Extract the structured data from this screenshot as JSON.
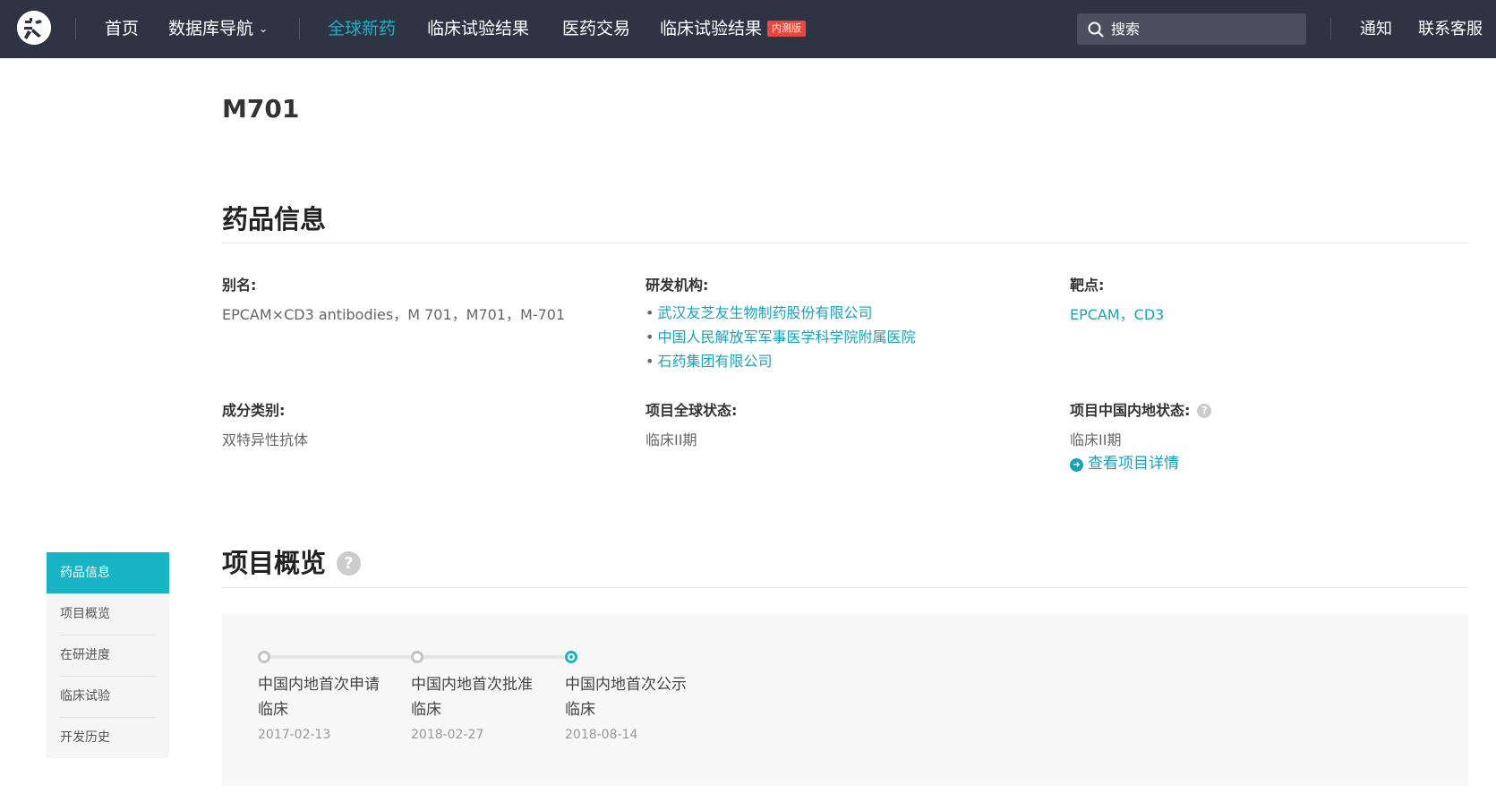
{
  "nav": {
    "items": [
      {
        "label": "首页"
      },
      {
        "label": "数据库导航",
        "caret": "⌄"
      },
      {
        "label": "全球新药",
        "active": true
      },
      {
        "label": "临床试验结果"
      },
      {
        "label": "医药交易"
      },
      {
        "label": "临床试验结果",
        "badge": "内测版"
      }
    ],
    "search_placeholder": "搜索",
    "right_items": [
      "通知",
      "联系客服"
    ],
    "accent_color": "#19b3c6",
    "badge_color": "#e8473b"
  },
  "drug": {
    "name": "M701"
  },
  "drug_info": {
    "title": "药品信息",
    "alias_label": "别名:",
    "alias_value": "EPCAM×CD3 antibodies，M 701，M701，M-701",
    "org_label": "研发机构:",
    "orgs": [
      "武汉友芝友生物制药股份有限公司",
      "中国人民解放军军事医学科学院附属医院",
      "石药集团有限公司"
    ],
    "target_label": "靶点:",
    "target_value": "EPCAM，CD3",
    "category_label": "成分类别:",
    "category_value": "双特异性抗体",
    "global_status_label": "项目全球状态:",
    "global_status_value": "临床II期",
    "china_status_label": "项目中国内地状态:",
    "china_status_value": "临床II期",
    "detail_link": "查看项目详情",
    "help_glyph": "?"
  },
  "overview": {
    "title": "项目概览",
    "help_glyph": "?",
    "milestones": [
      {
        "label": "中国内地首次申请临床",
        "date": "2017-02-13",
        "current": false
      },
      {
        "label": "中国内地首次批准临床",
        "date": "2018-02-27",
        "current": false
      },
      {
        "label": "中国内地首次公示临床",
        "date": "2018-08-14",
        "current": true
      }
    ]
  },
  "side_nav": {
    "items": [
      "药品信息",
      "项目概览",
      "在研进度",
      "临床试验",
      "开发历史"
    ],
    "active_index": 0
  }
}
